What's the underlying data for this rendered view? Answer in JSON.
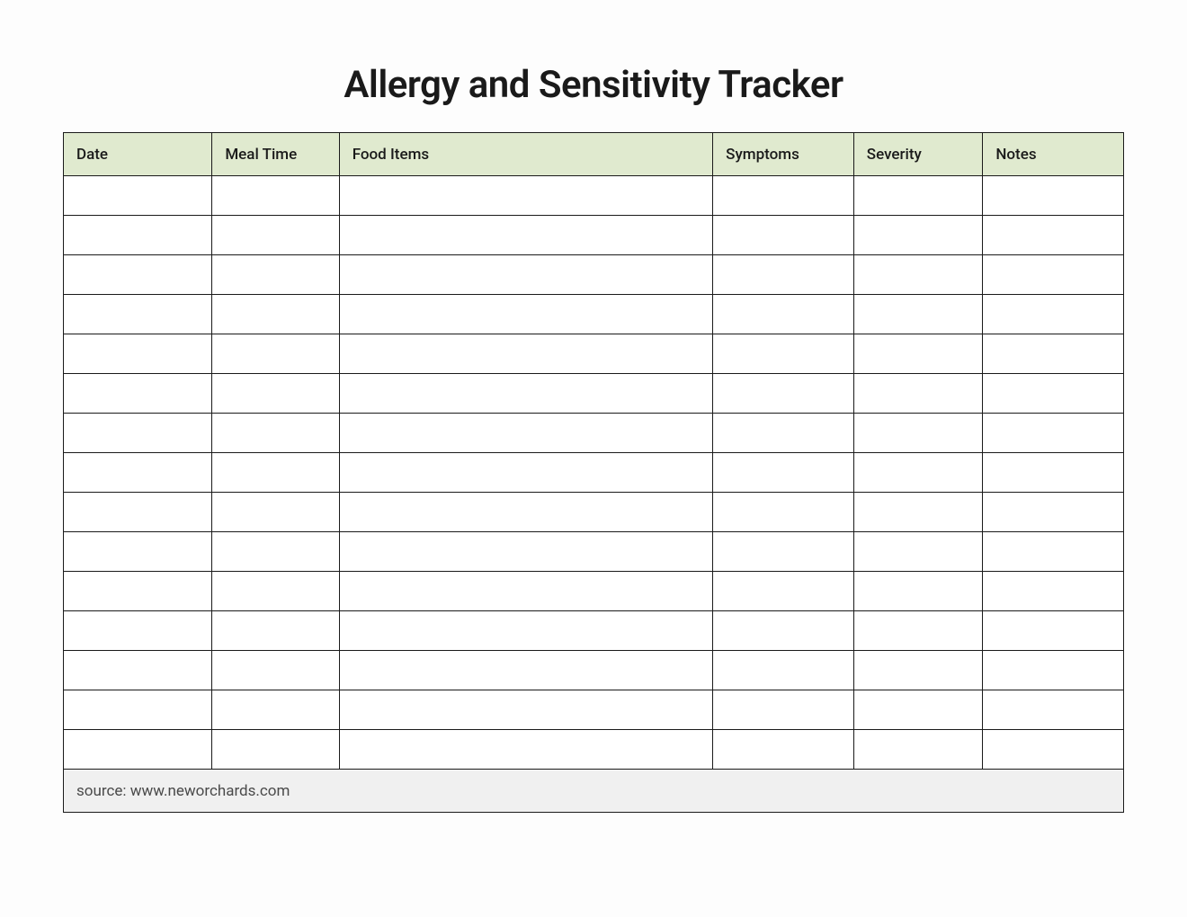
{
  "title": "Allergy and Sensitivity Tracker",
  "columns": [
    "Date",
    "Meal Time",
    "Food Items",
    "Symptoms",
    "Severity",
    "Notes"
  ],
  "rows": [
    [
      "",
      "",
      "",
      "",
      "",
      ""
    ],
    [
      "",
      "",
      "",
      "",
      "",
      ""
    ],
    [
      "",
      "",
      "",
      "",
      "",
      ""
    ],
    [
      "",
      "",
      "",
      "",
      "",
      ""
    ],
    [
      "",
      "",
      "",
      "",
      "",
      ""
    ],
    [
      "",
      "",
      "",
      "",
      "",
      ""
    ],
    [
      "",
      "",
      "",
      "",
      "",
      ""
    ],
    [
      "",
      "",
      "",
      "",
      "",
      ""
    ],
    [
      "",
      "",
      "",
      "",
      "",
      ""
    ],
    [
      "",
      "",
      "",
      "",
      "",
      ""
    ],
    [
      "",
      "",
      "",
      "",
      "",
      ""
    ],
    [
      "",
      "",
      "",
      "",
      "",
      ""
    ],
    [
      "",
      "",
      "",
      "",
      "",
      ""
    ],
    [
      "",
      "",
      "",
      "",
      "",
      ""
    ],
    [
      "",
      "",
      "",
      "",
      "",
      ""
    ]
  ],
  "footer": "source: www.neworchards.com"
}
